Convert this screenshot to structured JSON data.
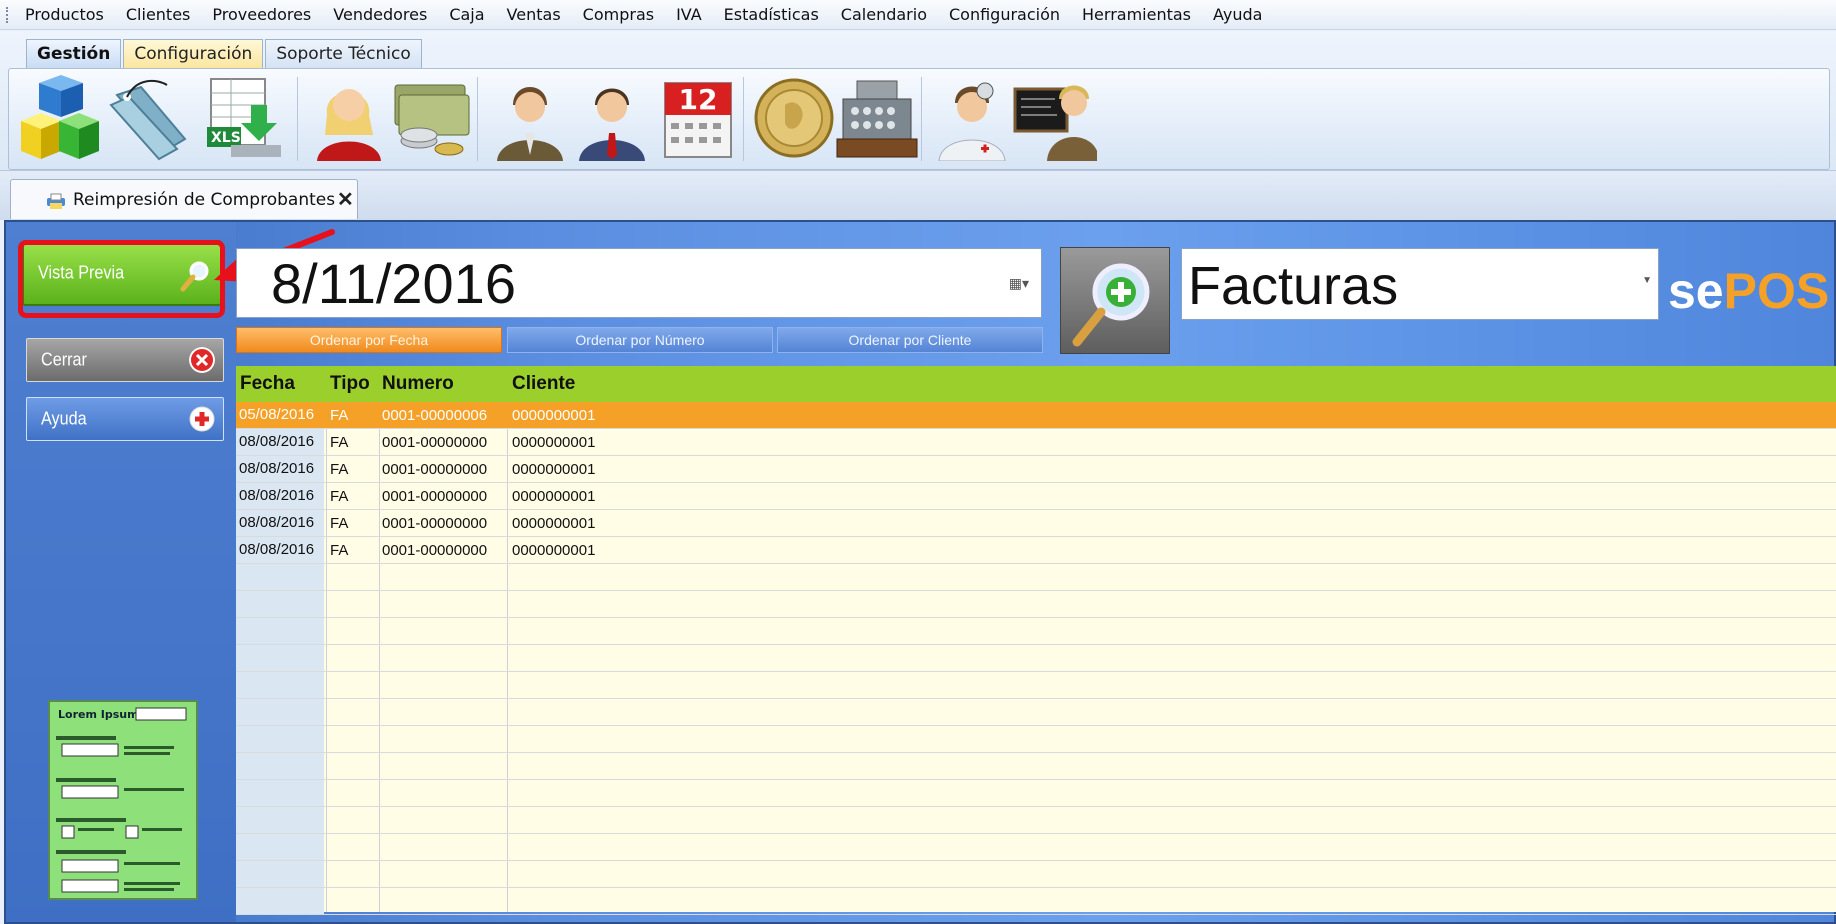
{
  "menu": [
    "Productos",
    "Clientes",
    "Proveedores",
    "Vendedores",
    "Caja",
    "Ventas",
    "Compras",
    "IVA",
    "Estadísticas",
    "Calendario",
    "Configuración",
    "Herramientas",
    "Ayuda"
  ],
  "ribbon": {
    "tabs": [
      "Gestión",
      "Configuración",
      "Soporte Técnico"
    ],
    "icons": [
      "cubes-icon",
      "tags-icon",
      "excel-import-icon",
      "user-female-icon",
      "money-icon",
      "user-male-icon",
      "user-tie-icon",
      "calendar-icon",
      "coin-icon",
      "cash-register-icon",
      "doctor-icon",
      "teacher-icon"
    ],
    "calendar_day": "12"
  },
  "doc_tab": {
    "label": "Reimpresión de Comprobantes",
    "close": "✕"
  },
  "sidebar": {
    "preview": "Vista Previa",
    "close": "Cerrar",
    "help": "Ayuda"
  },
  "filters": {
    "date": "8/11/2016",
    "doc_type": "Facturas"
  },
  "sort": {
    "by_date": "Ordenar por Fecha",
    "by_number": "Ordenar por Número",
    "by_client": "Ordenar por Cliente"
  },
  "brand": {
    "prefix": "se",
    "suffix": "POS"
  },
  "table": {
    "headers": [
      "Fecha",
      "Tipo",
      "Numero",
      "Cliente"
    ],
    "rows": [
      [
        "05/08/2016",
        "FA",
        "0001-00000006",
        "0000000001"
      ],
      [
        "08/08/2016",
        "FA",
        "0001-00000000",
        "0000000001"
      ],
      [
        "08/08/2016",
        "FA",
        "0001-00000000",
        "0000000001"
      ],
      [
        "08/08/2016",
        "FA",
        "0001-00000000",
        "0000000001"
      ],
      [
        "08/08/2016",
        "FA",
        "0001-00000000",
        "0000000001"
      ],
      [
        "08/08/2016",
        "FA",
        "0001-00000000",
        "0000000001"
      ]
    ],
    "selected_row": 0
  },
  "thumbnail": {
    "title": "Lorem Ipsum"
  },
  "colors": {
    "accent_green": "#9bcf2c",
    "selected_row": "#f5a027",
    "highlight": "#e8101a"
  }
}
